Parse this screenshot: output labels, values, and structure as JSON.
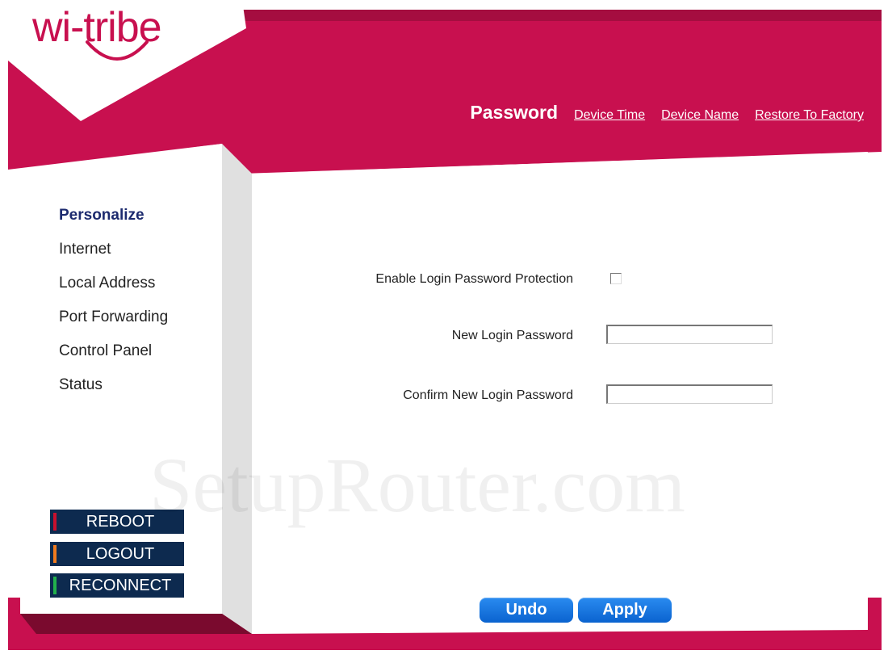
{
  "brand": {
    "logo_text": "wi-tribe",
    "accent_color": "#c8104f",
    "dark_accent_color": "#8a0a34"
  },
  "top_nav": {
    "current": "Password",
    "links": [
      "Device Time",
      "Device Name",
      "Restore To Factory"
    ]
  },
  "sidebar": {
    "items": [
      {
        "label": "Personalize",
        "active": true
      },
      {
        "label": "Internet",
        "active": false
      },
      {
        "label": "Local Address",
        "active": false
      },
      {
        "label": "Port Forwarding",
        "active": false
      },
      {
        "label": "Control Panel",
        "active": false
      },
      {
        "label": "Status",
        "active": false
      }
    ],
    "buttons": [
      {
        "label": "REBOOT",
        "color": "#c8102e"
      },
      {
        "label": "LOGOUT",
        "color": "#f07a1e"
      },
      {
        "label": "RECONNECT",
        "color": "#22b14c"
      }
    ]
  },
  "form": {
    "enable_label": "Enable Login Password Protection",
    "enable_checked": false,
    "new_password_label": "New Login Password",
    "new_password_value": "",
    "confirm_password_label": "Confirm New Login Password",
    "confirm_password_value": ""
  },
  "actions": {
    "undo_label": "Undo",
    "apply_label": "Apply"
  },
  "watermark": "SetupRouter.com"
}
